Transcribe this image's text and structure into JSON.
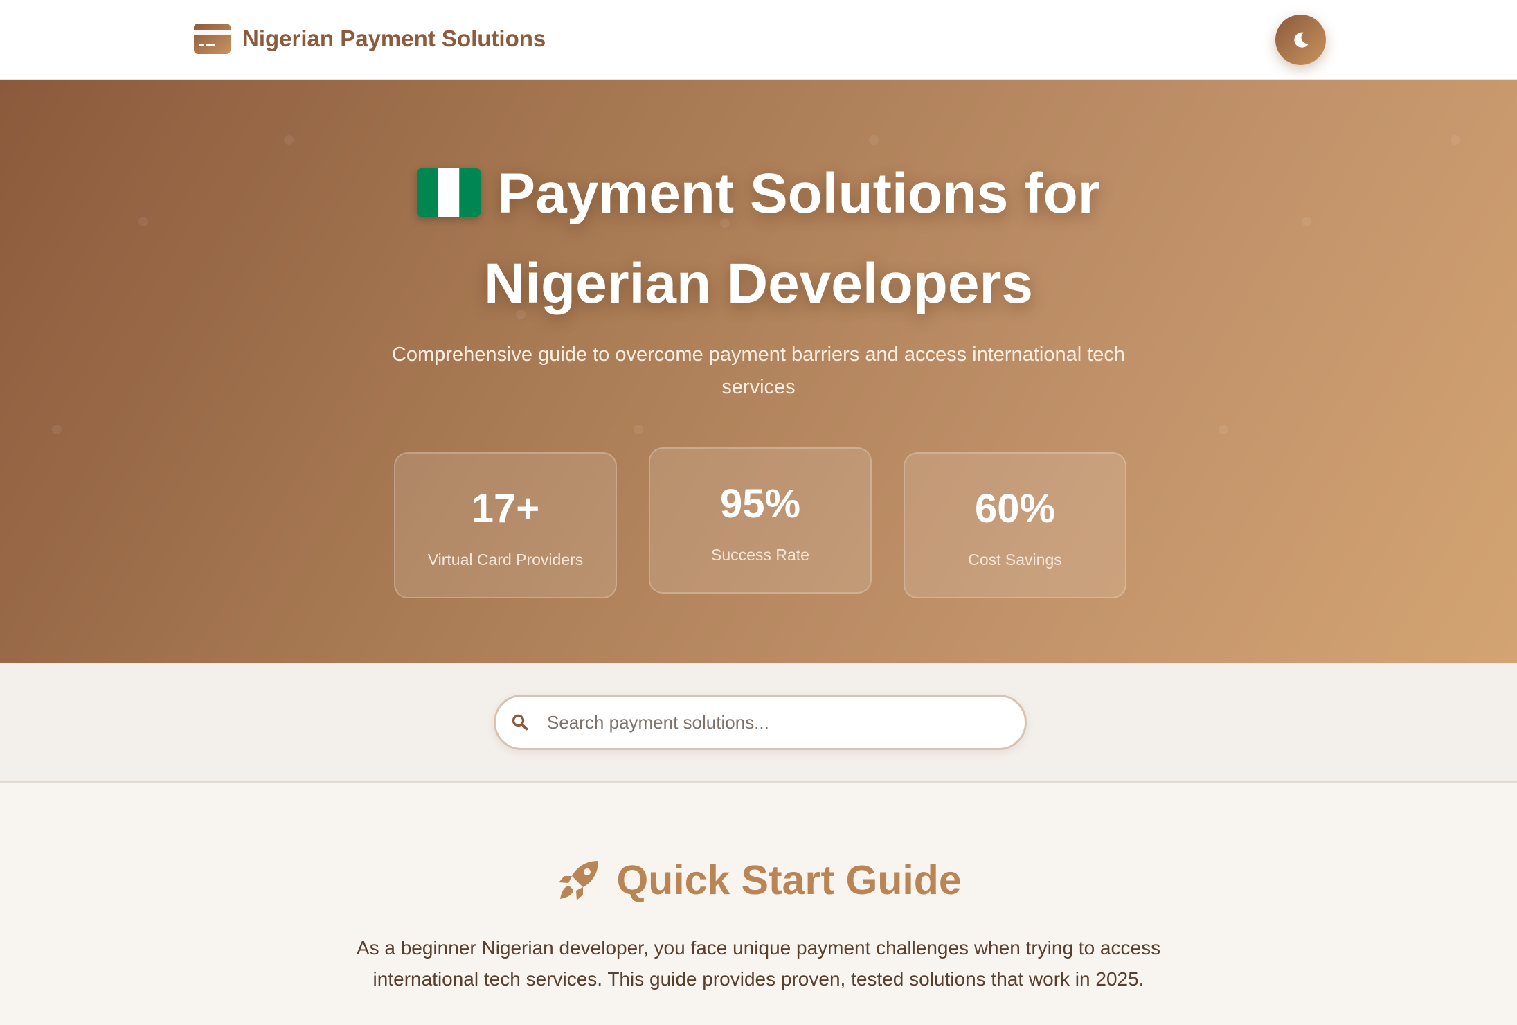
{
  "header": {
    "brand_title": "Nigerian Payment Solutions",
    "brand_icon": "credit-card-icon",
    "theme_toggle_icon": "moon-icon"
  },
  "hero": {
    "flag_icon": "nigeria-flag-icon",
    "title_line1": "Payment Solutions for",
    "title_line2": "Nigerian Developers",
    "subtitle": "Comprehensive guide to overcome payment barriers and access international tech services",
    "stats": [
      {
        "value": "17+",
        "label": "Virtual Card Providers"
      },
      {
        "value": "95%",
        "label": "Success Rate"
      },
      {
        "value": "60%",
        "label": "Cost Savings"
      }
    ]
  },
  "search": {
    "icon": "search-icon",
    "placeholder": "Search payment solutions...",
    "value": ""
  },
  "quick_start": {
    "icon": "rocket-icon",
    "heading": "Quick Start Guide",
    "text": "As a beginner Nigerian developer, you face unique payment challenges when trying to access international tech services. This guide provides proven, tested solutions that work in 2025."
  },
  "colors": {
    "brand": "#8c5a3c",
    "accent": "#b98555",
    "hero_start": "#8b5a3c",
    "hero_end": "#d3a472",
    "flag_green": "#008751"
  }
}
